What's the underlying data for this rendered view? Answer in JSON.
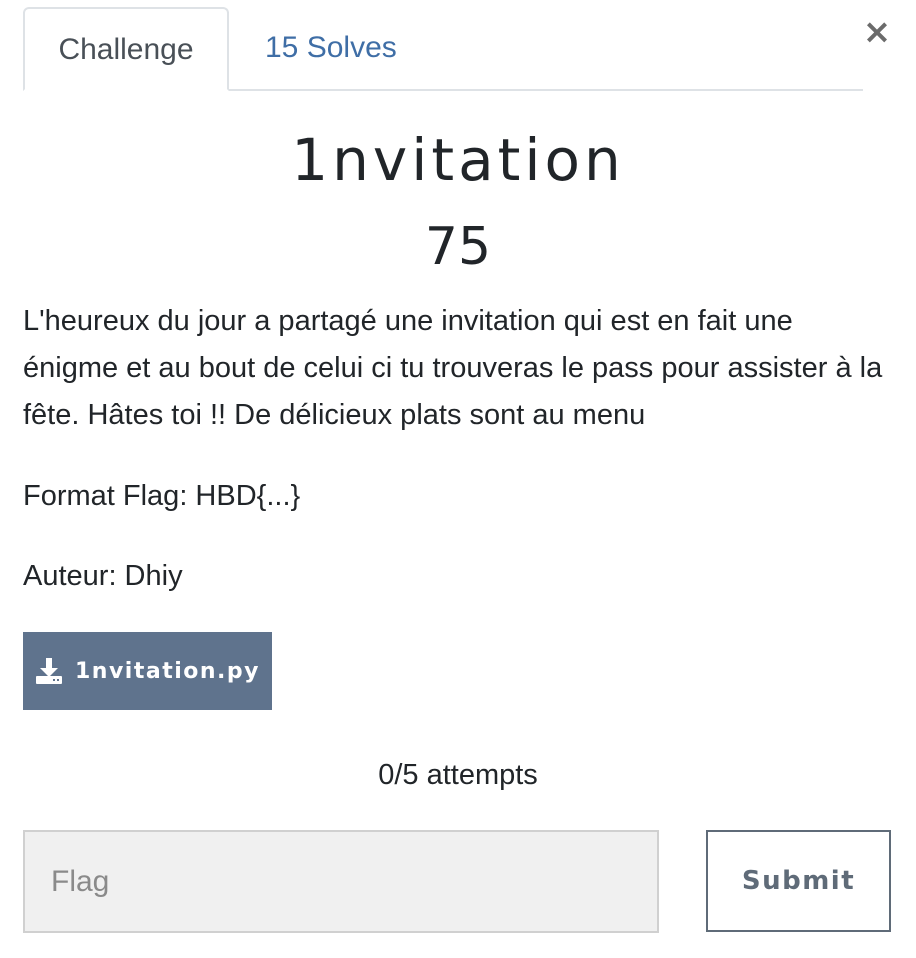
{
  "modal": {
    "close_label": "×"
  },
  "tabs": [
    {
      "label": "Challenge",
      "active": true
    },
    {
      "label": "15 Solves",
      "active": false
    }
  ],
  "challenge": {
    "name": "1nvitation",
    "value": "75",
    "description": "L'heureux du jour a partagé une invitation qui est en fait une énigme et au bout de celui ci tu trouveras le pass pour assister à la fête. Hâtes toi !! De délicieux plats sont au menu",
    "flag_format": "Format Flag: HBD{...}",
    "author": "Auteur: Dhiy"
  },
  "files": [
    {
      "name": "1nvitation.py",
      "icon": "download-icon"
    }
  ],
  "attempts": "0/5 attempts",
  "submission": {
    "placeholder": "Flag",
    "value": "",
    "submit_label": "Submit"
  },
  "colors": {
    "tab_link": "#3f6ea6",
    "file_button_bg": "#5f738d",
    "submit_border": "#5f6b78",
    "input_bg": "#f0f0f0"
  }
}
